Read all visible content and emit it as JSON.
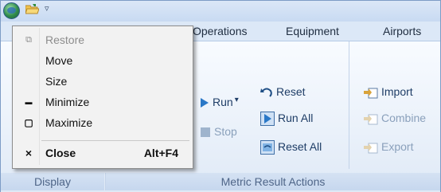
{
  "titlebar": {
    "quick_access_dropdown": "▿"
  },
  "tabs": [
    {
      "label": "Operations"
    },
    {
      "label": "Equipment"
    },
    {
      "label": "Airports"
    }
  ],
  "ribbon": {
    "run_label": "Run",
    "run_caret": "▾",
    "stop_label": "Stop",
    "reset_label": "Reset",
    "run_all_label": "Run All",
    "reset_all_label": "Reset All",
    "import_label": "Import",
    "combine_label": "Combine",
    "export_label": "Export",
    "group_display": "Display",
    "group_metric": "Metric Result Actions"
  },
  "system_menu": {
    "items": [
      {
        "label": "Restore",
        "icon": "restore-icon",
        "glyph": "⧉",
        "enabled": false
      },
      {
        "label": "Move",
        "icon": "",
        "glyph": "",
        "enabled": true
      },
      {
        "label": "Size",
        "icon": "",
        "glyph": "",
        "enabled": true
      },
      {
        "label": "Minimize",
        "icon": "minimize-icon",
        "glyph": "▬",
        "enabled": true
      },
      {
        "label": "Maximize",
        "icon": "maximize-icon",
        "glyph": "▢",
        "enabled": true
      },
      {
        "label": "Close",
        "icon": "close-icon",
        "glyph": "×",
        "enabled": true,
        "shortcut": "Alt+F4"
      }
    ]
  },
  "colors": {
    "accent": "#2d6fb4",
    "ribbon_bg": "#eaf1fa",
    "menu_bg": "#f2f2f2"
  }
}
